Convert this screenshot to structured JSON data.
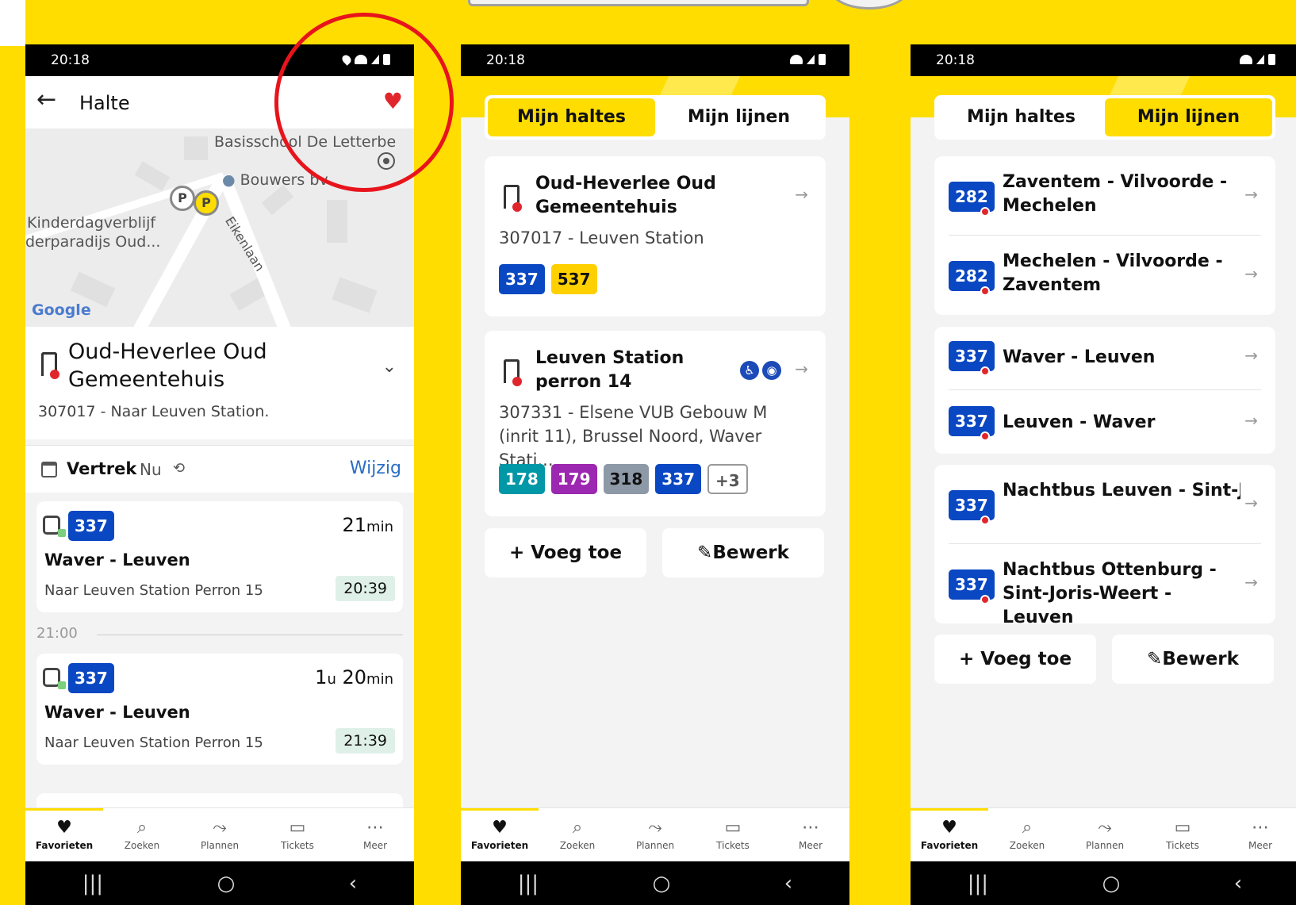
{
  "colors": {
    "accent": "#ffdd00",
    "badge_blue": "#0a47c2",
    "badge_yellow": "#ffd000",
    "badge_teal": "#0097a7",
    "badge_purple": "#9c27b0",
    "badge_grey": "#8e99a8",
    "heart_red": "#e0262c",
    "link_blue": "#2b6ec4"
  },
  "status_time": "20:18",
  "nav": [
    "Favorieten",
    "Zoeken",
    "Plannen",
    "Tickets",
    "Meer"
  ],
  "phone1": {
    "title": "Halte",
    "map": {
      "labels": [
        "Basisschool De Letterbe",
        "Bouwers bv",
        "Kinderdagverblijf",
        "derparadijs Oud...",
        "Eikenlaan"
      ],
      "google": "Google"
    },
    "stop_name": "Oud-Heverlee Oud Gemeentehuis",
    "stop_sub": "307017 - Naar Leuven Station.",
    "vertrek_label": "Vertrek",
    "vertrek_now": "Nu",
    "wijzig": "Wijzig",
    "hour_label": "21:00",
    "departures": [
      {
        "line": "337",
        "min_num": "21",
        "min_unit": "min",
        "direction": "Waver - Leuven",
        "dest": "Naar Leuven Station Perron 15",
        "time": "20:39"
      },
      {
        "line": "337",
        "min_num": "1",
        "min_unit": "u",
        "min_num2": "20",
        "min_unit2": "min",
        "direction": "Waver - Leuven",
        "dest": "Naar Leuven Station Perron 15",
        "time": "21:39"
      }
    ]
  },
  "phone2": {
    "tab_haltes": "Mijn haltes",
    "tab_lijnen": "Mijn lijnen",
    "stops": [
      {
        "name": "Oud-Heverlee Oud Gemeentehuis",
        "sub": "307017 - Leuven Station",
        "lines": [
          "337",
          "537"
        ]
      },
      {
        "name": "Leuven Station perron 14",
        "sub": "307331 - Elsene VUB Gebouw M (inrit 11), Brussel Noord, Waver Stati...",
        "lines": [
          "178",
          "179",
          "318",
          "337",
          "+3"
        ]
      }
    ],
    "add_label": "Voeg toe",
    "edit_label": "Bewerk"
  },
  "phone3": {
    "tab_haltes": "Mijn haltes",
    "tab_lijnen": "Mijn lijnen",
    "lines": [
      {
        "num": "282",
        "name": "Zaventem - Vilvoorde - Mechelen"
      },
      {
        "num": "282",
        "name": "Mechelen - Vilvoorde - Zaventem"
      },
      {
        "num": "337",
        "name": "Waver - Leuven"
      },
      {
        "num": "337",
        "name": "Leuven - Waver"
      },
      {
        "num": "337",
        "name": "Nachtbus Leuven - Sint-Joris-Weert - Otten..."
      },
      {
        "num": "337",
        "name": "Nachtbus Ottenburg - Sint-Joris-Weert - Leuven"
      }
    ],
    "add_label": "Voeg toe",
    "edit_label": "Bewerk"
  }
}
